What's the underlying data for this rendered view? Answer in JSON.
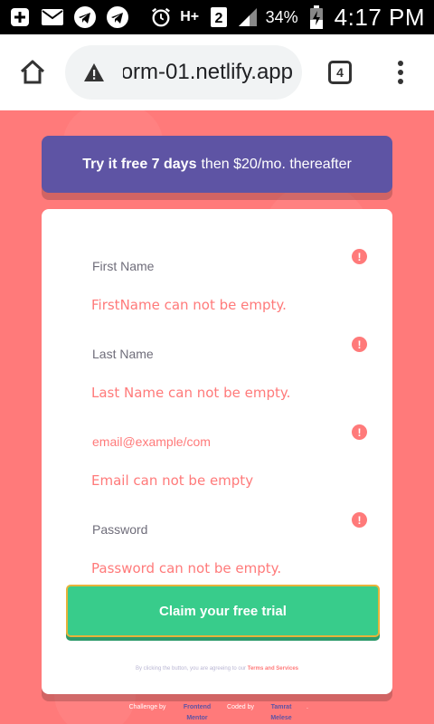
{
  "status_bar": {
    "battery_percent": "34%",
    "time": "4:17 PM",
    "icons": [
      "add-box-icon",
      "mail-icon",
      "telegram-icon",
      "telegram-icon",
      "alarm-icon",
      "hplus-icon",
      "sim-2-icon",
      "signal-icon",
      "battery-charging-icon"
    ]
  },
  "browser": {
    "url": "orm-01.netlify.app",
    "tab_count": "4"
  },
  "promo": {
    "bold": "Try it free 7 days",
    "rest": "then $20/mo. thereafter"
  },
  "form": {
    "fields": [
      {
        "placeholder": "First Name",
        "error": "FirstName can not be empty."
      },
      {
        "placeholder": "Last Name",
        "error": "Last Name can not be empty."
      },
      {
        "placeholder": "email@example/com",
        "error": "Email can not be empty"
      },
      {
        "placeholder": "Password",
        "error": "Password can not be empty."
      }
    ],
    "error_icon": "!",
    "submit_label": "Claim your free trial",
    "terms_prefix": "By clicking the button, you are agreeing to our",
    "terms_link": "Terms and Services"
  },
  "attribution": {
    "challenge_by": "Challenge by",
    "frontend_mentor": "Frontend Mentor",
    "coded_by": "Coded by",
    "author": "Tamrat Melese",
    "period": "."
  },
  "colors": {
    "background": "#ff7a7a",
    "promo": "#5e54a4",
    "cta": "#38cc8b",
    "error": "#ff7a7a"
  }
}
